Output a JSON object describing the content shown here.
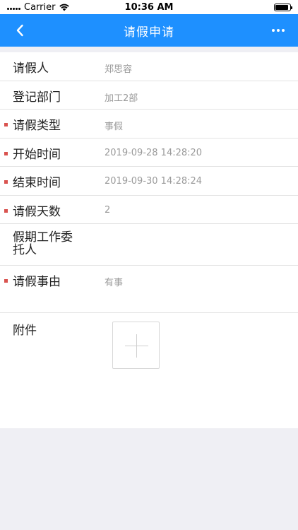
{
  "status_bar": {
    "carrier": "Carrier",
    "time": "10:36 AM"
  },
  "nav": {
    "title": "请假申请",
    "back_icon": "chevron-left-icon",
    "more_icon": "more-dots-icon"
  },
  "form": {
    "requester": {
      "label": "请假人",
      "value": "郑思容"
    },
    "department": {
      "label": "登记部门",
      "value": "加工2部"
    },
    "leave_type": {
      "label": "请假类型",
      "value": "事假"
    },
    "start_time": {
      "label": "开始时间",
      "value": "2019-09-28 14:28:20"
    },
    "end_time": {
      "label": "结束时间",
      "value": "2019-09-30 14:28:24"
    },
    "days": {
      "label": "请假天数",
      "value": "2"
    },
    "delegate": {
      "label": "假期工作委托人",
      "value": ""
    },
    "reason": {
      "label": "请假事由",
      "value": "有事"
    },
    "attachment": {
      "label": "附件"
    }
  },
  "colors": {
    "nav_bg": "#1e90ff",
    "required_marker": "#d9534f",
    "page_bg": "#efeff4"
  }
}
